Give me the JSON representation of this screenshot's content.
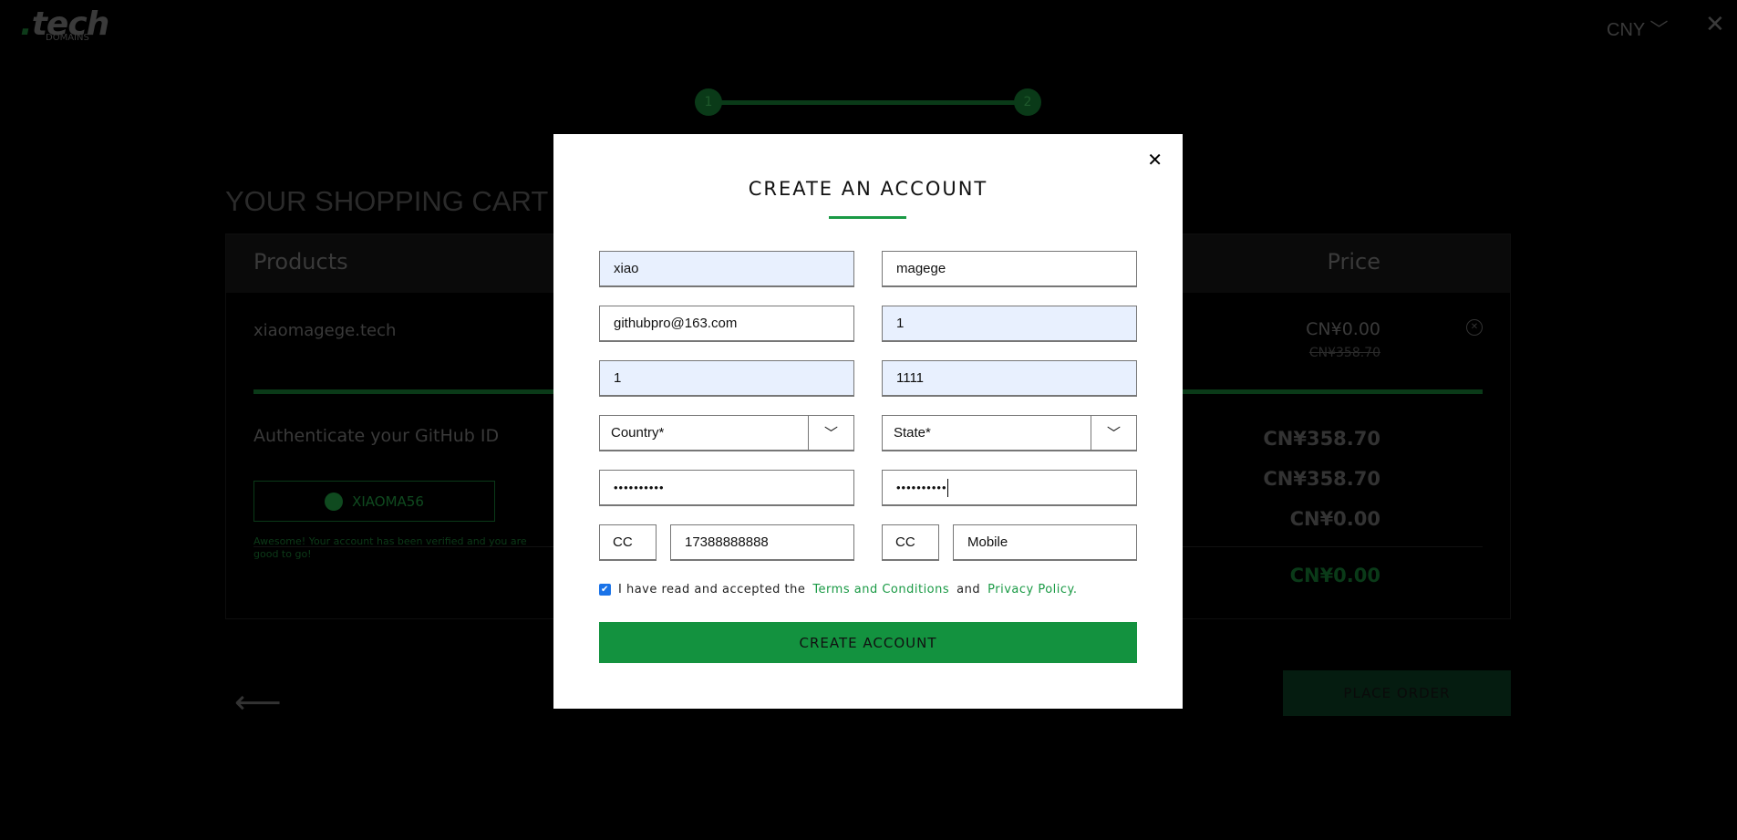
{
  "header": {
    "logo_text": ".tech",
    "logo_sub": "DOMAINS",
    "currency": "CNY",
    "close": "✕"
  },
  "steps": [
    "1",
    "2"
  ],
  "cart": {
    "title": "YOUR SHOPPING CART",
    "col_products": "Products",
    "col_price": "Price",
    "item": {
      "name": "xiaomagege.tech",
      "price": "CN¥0.00",
      "original_price": "CN¥358.70"
    },
    "github": {
      "heading": "Authenticate your GitHub ID",
      "username": "XIAOMA56",
      "message": "Awesome! Your account has been verified and you are good to go!"
    },
    "totals": [
      "CN¥358.70",
      "CN¥358.70",
      "CN¥0.00"
    ],
    "grand_total": "CN¥0.00",
    "place_order": "PLACE ORDER"
  },
  "modal": {
    "title": "CREATE AN ACCOUNT",
    "close": "✕",
    "first_name": "xiao",
    "last_name": "magege",
    "email": "githubpro@163.com",
    "field_r2": "1",
    "field_r3a": "1",
    "field_r3b": "1111",
    "country_placeholder": "Country*",
    "state_placeholder": "State*",
    "password": "••••••••••",
    "confirm_password": "••••••••••",
    "cc1": "CC",
    "phone": "17388888888",
    "cc2": "CC",
    "mobile_placeholder": "Mobile",
    "terms_prefix": "I have read and accepted the",
    "terms_link": "Terms and Conditions",
    "terms_and": "and",
    "privacy_link": "Privacy Policy.",
    "terms_checked": true,
    "submit": "CREATE ACCOUNT"
  },
  "colors": {
    "accent": "#13923f",
    "autofill": "#e8f0fe"
  }
}
